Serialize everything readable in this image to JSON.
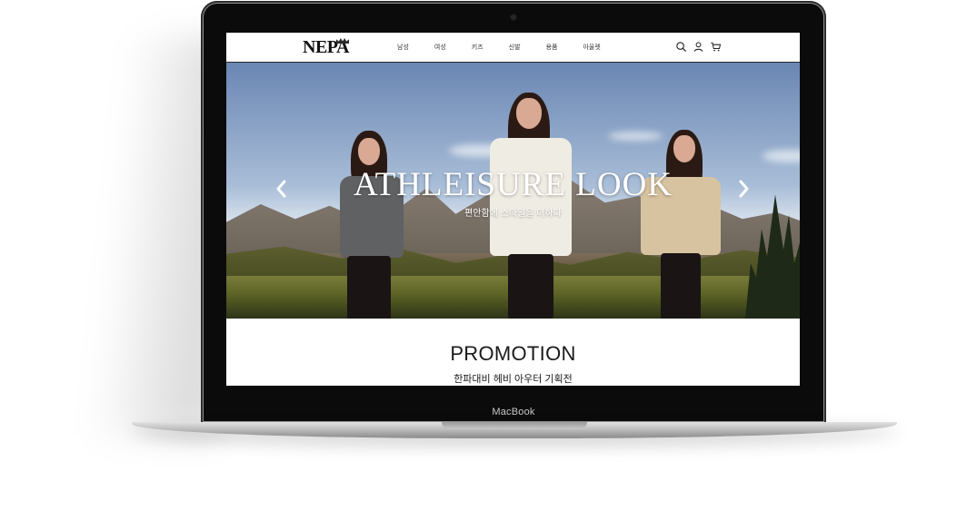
{
  "device": {
    "label": "MacBook"
  },
  "site": {
    "brand": "NEPA",
    "nav": [
      "남성",
      "여성",
      "키즈",
      "신발",
      "용품",
      "아울렛"
    ],
    "icons": [
      "search-icon",
      "user-icon",
      "cart-icon"
    ]
  },
  "hero": {
    "title": "ATHLEISURE LOOK",
    "subtitle": "편안함에 스타일을 더하다",
    "prev_icon": "chevron-left-icon",
    "next_icon": "chevron-right-icon"
  },
  "promotion": {
    "title": "PROMOTION",
    "subtitle": "한파대비 헤비 아우터 기획전"
  },
  "colors": {
    "bezel": "#0b0b0b",
    "header_border": "#2b2b2b",
    "hero_text": "#ffffff"
  }
}
